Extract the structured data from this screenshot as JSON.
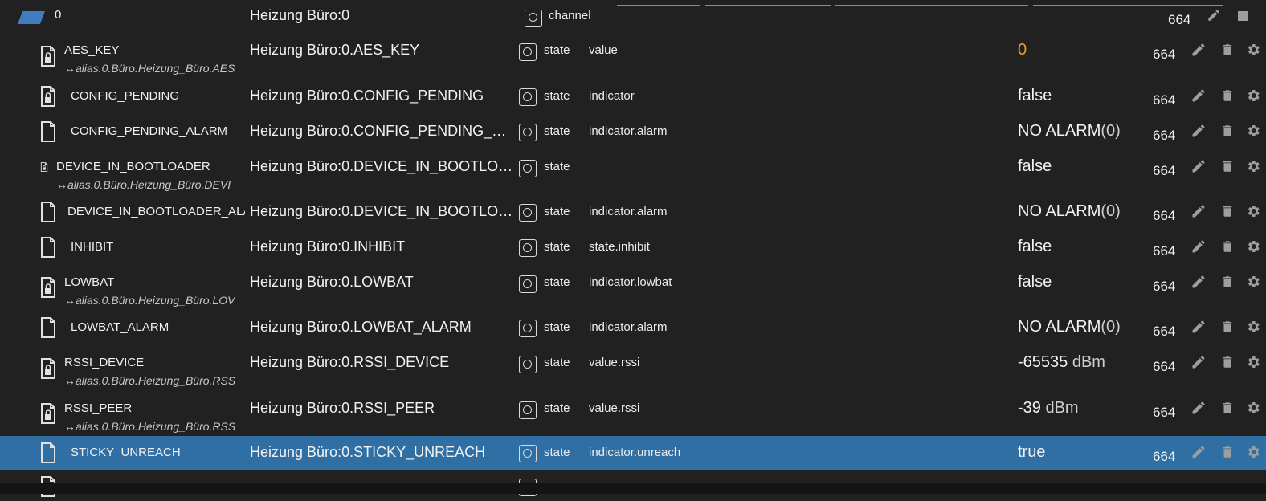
{
  "top": {
    "name": "0",
    "label": "Heizung Büro:0",
    "type": "channel",
    "acl": "664"
  },
  "rows": [
    {
      "name": "AES_KEY",
      "alias": "↔alias.0.Büro.Heizung_Büro.AES",
      "label": "Heizung Büro:0.AES_KEY",
      "type": "state",
      "role": "value",
      "value": "0",
      "unit": "",
      "acl": "664",
      "icon": "locked-file-icon",
      "orange": true
    },
    {
      "name": "CONFIG_PENDING",
      "alias": "",
      "label": "Heizung Büro:0.CONFIG_PENDING",
      "type": "state",
      "role": "indicator",
      "value": "false",
      "unit": "",
      "acl": "664",
      "icon": "locked-file-icon"
    },
    {
      "name": "CONFIG_PENDING_ALARM",
      "alias": "",
      "label": "Heizung Büro:0.CONFIG_PENDING_AL...",
      "type": "state",
      "role": "indicator.alarm",
      "value": "NO ALARM",
      "unit": "(0)",
      "acl": "664",
      "icon": "file-icon"
    },
    {
      "name": "DEVICE_IN_BOOTLOADER",
      "alias": "↔alias.0.Büro.Heizung_Büro.DEVI",
      "label": "Heizung Büro:0.DEVICE_IN_BOOTLOA...",
      "type": "state",
      "role": "",
      "value": "false",
      "unit": "",
      "acl": "664",
      "icon": "locked-file-icon",
      "smallIcon": true
    },
    {
      "name": "DEVICE_IN_BOOTLOADER_ALAI",
      "alias": "",
      "label": "Heizung Büro:0.DEVICE_IN_BOOTLOA...",
      "type": "state",
      "role": "indicator.alarm",
      "value": "NO ALARM",
      "unit": "(0)",
      "acl": "664",
      "icon": "file-icon"
    },
    {
      "name": "INHIBIT",
      "alias": "",
      "label": "Heizung Büro:0.INHIBIT",
      "type": "state",
      "role": "state.inhibit",
      "value": "false",
      "unit": "",
      "acl": "664",
      "icon": "file-icon"
    },
    {
      "name": "LOWBAT",
      "alias": "↔alias.0.Büro.Heizung_Büro.LOV",
      "label": "Heizung Büro:0.LOWBAT",
      "type": "state",
      "role": "indicator.lowbat",
      "value": "false",
      "unit": "",
      "acl": "664",
      "icon": "locked-file-icon"
    },
    {
      "name": "LOWBAT_ALARM",
      "alias": "",
      "label": "Heizung Büro:0.LOWBAT_ALARM",
      "type": "state",
      "role": "indicator.alarm",
      "value": "NO ALARM",
      "unit": "(0)",
      "acl": "664",
      "icon": "file-icon"
    },
    {
      "name": "RSSI_DEVICE",
      "alias": "↔alias.0.Büro.Heizung_Büro.RSS",
      "label": "Heizung Büro:0.RSSI_DEVICE",
      "type": "state",
      "role": "value.rssi",
      "value": "-65535",
      "unit": " dBm",
      "acl": "664",
      "icon": "locked-file-icon"
    },
    {
      "name": "RSSI_PEER",
      "alias": "↔alias.0.Büro.Heizung_Büro.RSS",
      "label": "Heizung Büro:0.RSSI_PEER",
      "type": "state",
      "role": "value.rssi",
      "value": "-39",
      "unit": " dBm",
      "acl": "664",
      "icon": "locked-file-icon"
    },
    {
      "name": "STICKY_UNREACH",
      "alias": "",
      "label": "Heizung Büro:0.STICKY_UNREACH",
      "type": "state",
      "role": "indicator.unreach",
      "value": "true",
      "unit": "",
      "acl": "664",
      "icon": "file-icon",
      "selected": true
    }
  ],
  "colors": {
    "background": "#212121",
    "selected": "#2f6fa3",
    "orange_value": "#f0a020"
  }
}
